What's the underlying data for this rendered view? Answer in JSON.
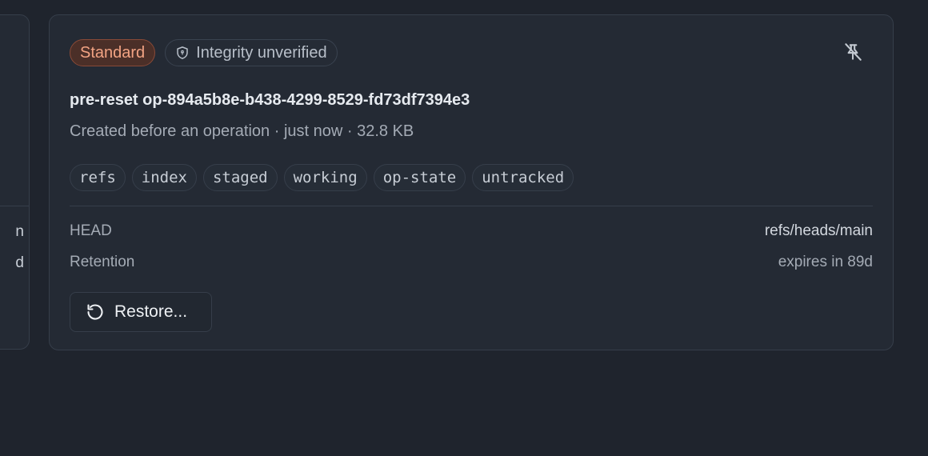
{
  "prev_card": {
    "peek_row_1": "n",
    "peek_row_2": "d"
  },
  "card": {
    "badges": {
      "tier": "Standard",
      "integrity": "Integrity unverified"
    },
    "icons": {
      "integrity": "shield-icon",
      "unpin": "pin-off-icon",
      "restore": "rotate-ccw-icon"
    },
    "title": "pre-reset op-894a5b8e-b438-4299-8529-fd73df7394e3",
    "meta": "Created before an operation · just now · 32.8 KB",
    "tags": [
      "refs",
      "index",
      "staged",
      "working",
      "op-state",
      "untracked"
    ],
    "details": {
      "head_label": "HEAD",
      "head_value": "refs/heads/main",
      "retention_label": "Retention",
      "retention_value": "expires in 89d"
    },
    "restore_label": "Restore..."
  },
  "colors": {
    "background": "#1f242d",
    "card": "#242a34",
    "border": "#363e4a",
    "standard_badge_text": "#f2a383",
    "standard_badge_bg": "#4b2f28"
  }
}
